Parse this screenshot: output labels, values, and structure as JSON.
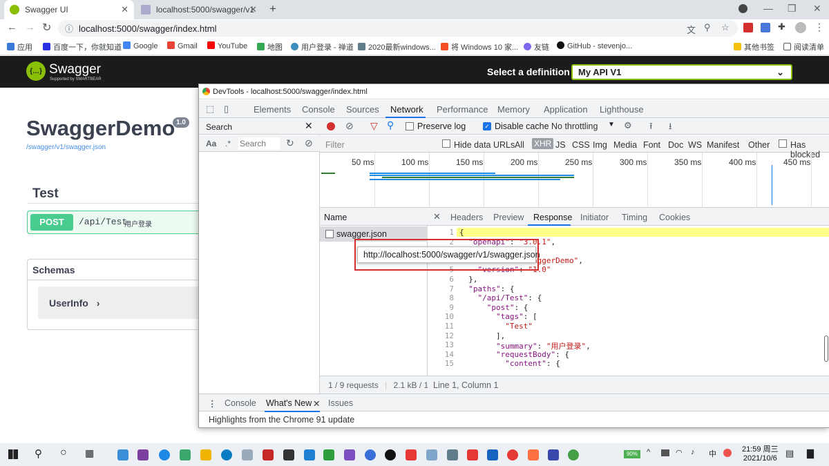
{
  "browser": {
    "tabs": [
      {
        "title": "Swagger UI",
        "active": true
      },
      {
        "title": "localhost:5000/swagger/v1/sw",
        "active": false
      }
    ],
    "address": "localhost:5000/swagger/index.html",
    "bookmarks": [
      "应用",
      "百度一下，你就知道",
      "Google",
      "Gmail",
      "YouTube",
      "地图",
      "用户登录 - 禅道",
      "2020最新windows...",
      "将 Windows 10 家...",
      "友链",
      "GitHub - stevenjo...",
      "其他书签",
      "阅读清单"
    ]
  },
  "swagger": {
    "brand": "Swagger",
    "brand_sub": "Supported by SMARTBEAR",
    "select_label": "Select a definition",
    "definition": "My API V1",
    "title": "SwaggerDemo",
    "version": "1.0",
    "spec_url": "/swagger/v1/swagger.json",
    "section": "Test",
    "op_method": "POST",
    "op_path": "/api/Test",
    "op_summary": "用户登录",
    "schemas_title": "Schemas",
    "schema_name": "UserInfo",
    "schema_arrow": "›"
  },
  "devtools": {
    "title": "DevTools - localhost:5000/swagger/index.html",
    "tabs": [
      "Elements",
      "Console",
      "Sources",
      "Network",
      "Performance",
      "Memory",
      "Application",
      "Lighthouse"
    ],
    "active_tab": "Network",
    "search_title": "Search",
    "search_aa": "Aa",
    "search_regex": ".*",
    "search_placeholder": "Search",
    "preserve_log": "Preserve log",
    "disable_cache": "Disable cache",
    "throttling": "No throttling",
    "filter_placeholder": "Filter",
    "hide_data_urls": "Hide data URLs",
    "filter_types": [
      "All",
      "XHR",
      "JS",
      "CSS",
      "Img",
      "Media",
      "Font",
      "Doc",
      "WS",
      "Manifest",
      "Other"
    ],
    "has_blocked": "Has blocked",
    "timeline_ticks": [
      "50 ms",
      "100 ms",
      "150 ms",
      "200 ms",
      "250 ms",
      "300 ms",
      "350 ms",
      "400 ms",
      "450 ms"
    ],
    "name_header": "Name",
    "request_name": "swagger.json",
    "request_stats": "1 / 9 requests",
    "transfer": "2.1 kB / 1.",
    "detail_tabs": [
      "Headers",
      "Preview",
      "Response",
      "Initiator",
      "Timing",
      "Cookies"
    ],
    "active_detail_tab": "Response",
    "cursor_status": "Line 1, Column 1",
    "drawer_tabs": [
      "Console",
      "What's New",
      "Issues"
    ],
    "drawer_message": "Highlights from the Chrome 91 update",
    "tooltip": "http://localhost:5000/swagger/v1/swagger.json",
    "code_lines": [
      "{",
      "  \"openapi\": \"3.0.1\",",
      "",
      "    \"title\": \"SwaggerDemo\",",
      "    \"version\": \"1.0\"",
      "  },",
      "  \"paths\": {",
      "    \"/api/Test\": {",
      "      \"post\": {",
      "        \"tags\": [",
      "          \"Test\"",
      "        ],",
      "        \"summary\": \"用户登录\",",
      "        \"requestBody\": {",
      "          \"content\": {"
    ]
  },
  "taskbar": {
    "battery": "90%",
    "ime": "中",
    "time": "21:59 周三",
    "date": "2021/10/6"
  }
}
